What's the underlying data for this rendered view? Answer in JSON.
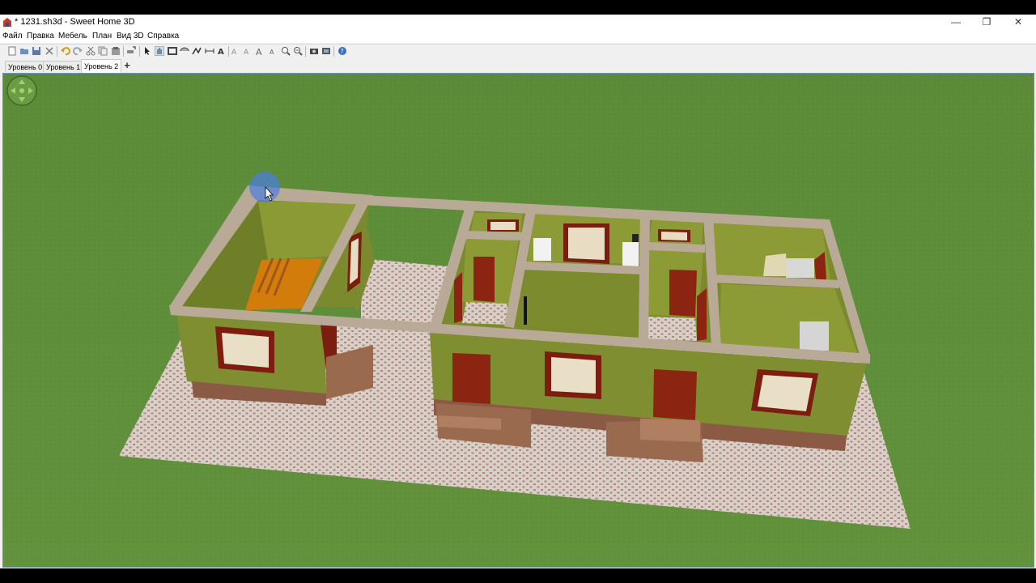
{
  "window": {
    "title": "* 1231.sh3d - Sweet Home 3D",
    "controls": [
      "minimize",
      "maximize",
      "close"
    ]
  },
  "menu": [
    "Файл",
    "Правка",
    "Мебель",
    "План",
    "Вид 3D",
    "Справка"
  ],
  "toolbar": {
    "buttons": [
      "new-home-icon",
      "open-icon",
      "save-icon",
      "cut-icon",
      "undo-icon",
      "redo-icon",
      "cut-icon",
      "copy-icon",
      "paste-icon",
      "add-furniture-icon",
      "select-icon",
      "pan-icon",
      "create-walls-icon",
      "create-rooms-icon",
      "create-polylines-icon",
      "create-dimensions-icon",
      "add-text-icon",
      "modify-text-style-icon",
      "increase-text-icon",
      "decrease-text-icon",
      "zoom-in-icon",
      "zoom-out-icon",
      "create-photo-icon",
      "create-video-icon",
      "help-icon"
    ]
  },
  "levels": {
    "tabs": [
      "Уровень 0",
      "Уровень 1",
      "Уровень 2"
    ],
    "selected": "Уровень 2",
    "add_label": "+"
  },
  "view3d": {
    "navigation": "navigation-arrows-icon",
    "colors": {
      "grass": "#5e8c3a",
      "wall_interior": "#7c8a2e",
      "wall_top": "#b4a592",
      "floor_tile": "#d8cfc8",
      "door": "#8b2410"
    }
  }
}
